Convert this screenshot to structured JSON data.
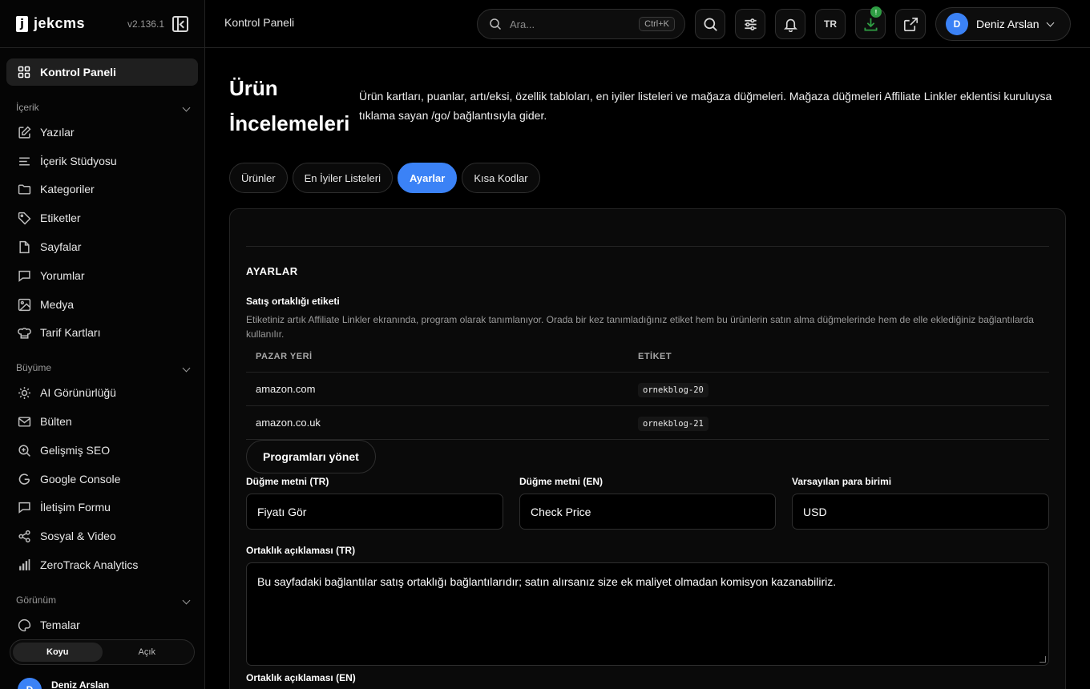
{
  "app": {
    "name": "jekcms",
    "version": "v2.136.1"
  },
  "sidebar": {
    "active": "Kontrol Paneli",
    "sections": [
      {
        "title": "İçerik",
        "items": [
          "Yazılar",
          "İçerik Stüdyosu",
          "Kategoriler",
          "Etiketler",
          "Sayfalar",
          "Yorumlar",
          "Medya",
          "Tarif Kartları"
        ]
      },
      {
        "title": "Büyüme",
        "items": [
          "AI Görünürlüğü",
          "Bülten",
          "Gelişmiş SEO",
          "Google Console",
          "İletişim Formu",
          "Sosyal & Video",
          "ZeroTrack Analytics"
        ]
      },
      {
        "title": "Görünüm",
        "items": [
          "Temalar"
        ]
      }
    ],
    "theme": {
      "dark": "Koyu",
      "light": "Açık"
    },
    "user": {
      "initial": "D",
      "name": "Deniz Arslan"
    }
  },
  "topbar": {
    "breadcrumb": "Kontrol Paneli",
    "search_placeholder": "Ara...",
    "search_shortcut": "Ctrl+K",
    "lang": "TR",
    "download_badge": "!",
    "user_initial": "D",
    "user_name": "Deniz Arslan"
  },
  "page": {
    "title": "Ürün İncelemeleri",
    "description": "Ürün kartları, puanlar, artı/eksi, özellik tabloları, en iyiler listeleri ve mağaza düğmeleri. Mağaza düğmeleri Affiliate Linkler eklentisi kuruluysa tıklama sayan /go/ bağlantısıyla gider."
  },
  "tabs": [
    "Ürünler",
    "En İyiler Listeleri",
    "Ayarlar",
    "Kısa Kodlar"
  ],
  "active_tab": "Ayarlar",
  "settings": {
    "section_title": "AYARLAR",
    "affiliate_tag_label": "Satış ortaklığı etiketi",
    "affiliate_tag_help": "Etiketiniz artık Affiliate Linkler ekranında, program olarak tanımlanıyor. Orada bir kez tanımladığınız etiket hem bu ürünlerin satın alma düğmelerinde hem de elle eklediğiniz bağlantılarda kullanılır.",
    "table_headers": [
      "PAZAR YERİ",
      "ETİKET"
    ],
    "table_rows": [
      [
        "amazon.com",
        "ornekblog-20"
      ],
      [
        "amazon.co.uk",
        "ornekblog-21"
      ]
    ],
    "manage_button": "Programları yönet",
    "button_text_tr_label": "Düğme metni (TR)",
    "button_text_tr_value": "Fiyatı Gör",
    "button_text_en_label": "Düğme metni (EN)",
    "button_text_en_value": "Check Price",
    "currency_label": "Varsayılan para birimi",
    "currency_value": "USD",
    "disclosure_tr_label": "Ortaklık açıklaması (TR)",
    "disclosure_tr_value": "Bu sayfadaki bağlantılar satış ortaklığı bağlantılarıdır; satın alırsanız size ek maliyet olmadan komisyon kazanabiliriz.",
    "disclosure_en_label": "Ortaklık açıklaması (EN)"
  },
  "colors": {
    "accent": "#3b82f6",
    "badge": "#2f9e44",
    "background": "#000000"
  }
}
